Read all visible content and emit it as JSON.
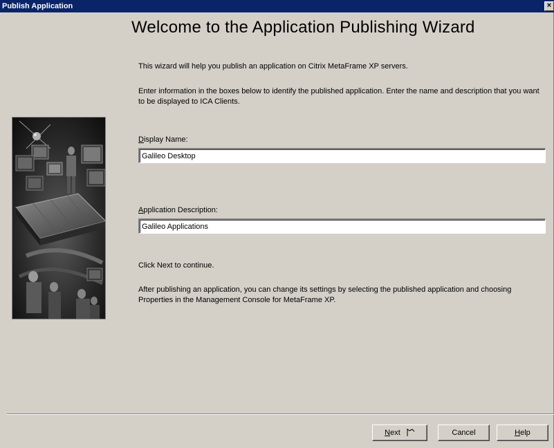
{
  "window": {
    "title": "Publish Application",
    "close_label": "×"
  },
  "wizard": {
    "heading": "Welcome to the Application Publishing Wizard",
    "intro": "This wizard will help you publish an application on Citrix MetaFrame XP servers.",
    "instructions": "Enter information in the boxes below to identify the published application.  Enter the name and description that you want to be displayed to ICA Clients.",
    "display_name": {
      "label_hotkey": "D",
      "label_rest": "isplay Name:",
      "value": "Galileo Desktop"
    },
    "description": {
      "label_hotkey": "A",
      "label_rest": "pplication Description:",
      "value": "Galileo Applications"
    },
    "continue_text": "Click Next to continue.",
    "after_text": "After publishing an application, you can change its settings by selecting the published application and choosing Properties in the Management Console for MetaFrame XP."
  },
  "buttons": {
    "next_hotkey": "N",
    "next_rest": "ext",
    "cancel": "Cancel",
    "help_hotkey": "H",
    "help_rest": "elp"
  },
  "colors": {
    "titlebar": "#0a246a",
    "dialog": "#d4d0c8"
  }
}
